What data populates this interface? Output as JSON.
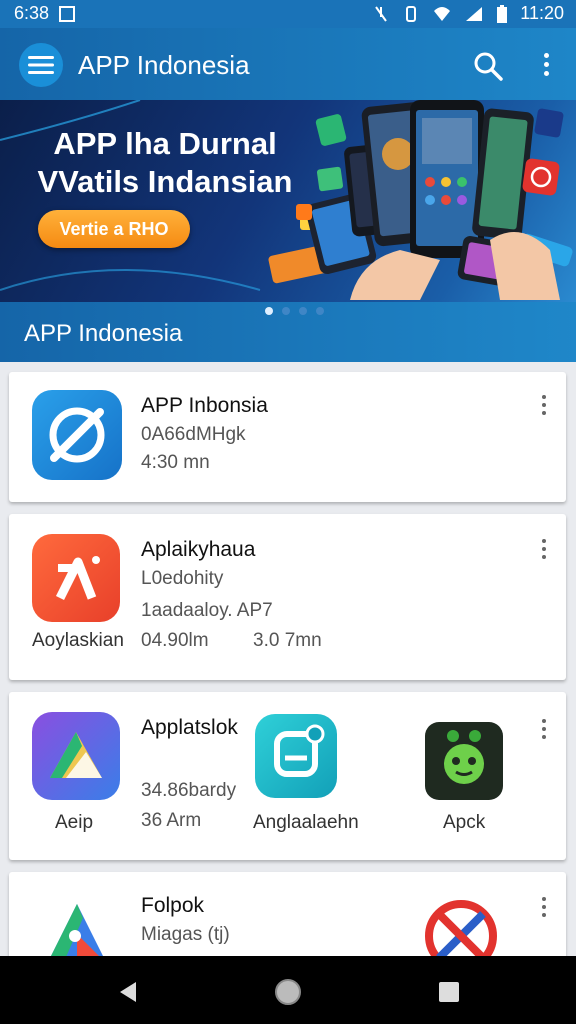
{
  "status_bar": {
    "left_text": "6:38",
    "time": "11:20"
  },
  "app_bar": {
    "title": "APP Indonesia"
  },
  "banner": {
    "line1": "APP lha Durnal",
    "line2": "VVatils Indansian",
    "cta": "Vertie a RHO"
  },
  "section": {
    "title": "APP Indonesia"
  },
  "cards": [
    {
      "title": "APP Inbonsia",
      "line1": "0A66dMHgk",
      "line2": "4:30 mn"
    },
    {
      "title": "Aplaikyhaua",
      "line1": "L0edohity",
      "line2": "1aadaaloy.  AP7",
      "icon_label": "Aoylaskian",
      "meta_a": "04.90lm",
      "meta_b": "3.0 7mn"
    },
    {
      "title": "Applatslok",
      "line1": "34.86bardy",
      "line2": "36 Arm",
      "icon_label_1": "Aeip",
      "icon_label_2": "Anglaalaehn",
      "icon_label_3": "Apck"
    },
    {
      "title": "Folpok",
      "line1": "Miagas (tj)"
    }
  ],
  "colors": {
    "primary": "#1a73b8",
    "accent": "#f58a12"
  }
}
